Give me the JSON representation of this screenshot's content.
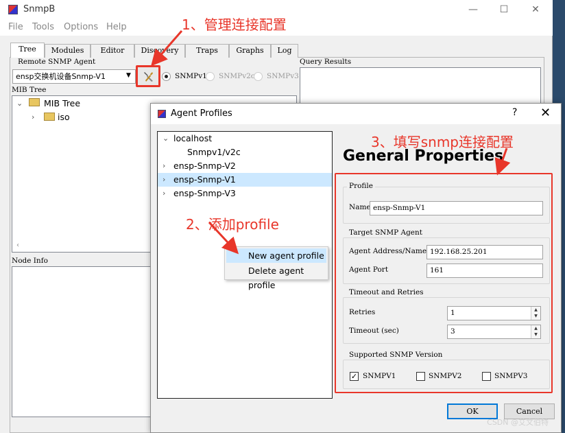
{
  "window": {
    "title": "SnmpB"
  },
  "menu": [
    "File",
    "Tools",
    "Options",
    "Help"
  ],
  "tabs": [
    "Tree",
    "Modules",
    "Editor",
    "Discovery",
    "Traps",
    "Graphs",
    "Log"
  ],
  "remote_agent": {
    "group_label": "Remote SNMP Agent",
    "selected_agent": "ensp交换机设备Snmp-V1",
    "versions": [
      "SNMPv1",
      "SNMPv2c",
      "SNMPv3"
    ],
    "selected_version": "SNMPv1"
  },
  "query_results_label": "Query Results",
  "mib_tree": {
    "label": "MIB Tree",
    "root": "MIB Tree",
    "child": "iso"
  },
  "node_info_label": "Node Info",
  "dialog": {
    "title": "Agent Profiles",
    "help": "?",
    "close": "✕",
    "profiles": [
      {
        "name": "localhost",
        "expanded": true
      },
      {
        "name": "Snmpv1/v2c",
        "child": true
      },
      {
        "name": "ensp-Snmp-V2"
      },
      {
        "name": "ensp-Snmp-V1",
        "selected": true
      },
      {
        "name": "ensp-Snmp-V3"
      }
    ],
    "context_menu": [
      "New agent profile",
      "Delete agent profile"
    ],
    "heading": "General Properties",
    "profile": {
      "legend": "Profile",
      "name_label": "Name",
      "name_value": "ensp-Snmp-V1"
    },
    "target": {
      "legend": "Target SNMP Agent",
      "address_label": "Agent Address/Name",
      "address_value": "192.168.25.201",
      "port_label": "Agent Port",
      "port_value": "161"
    },
    "timeout": {
      "legend": "Timeout and Retries",
      "retries_label": "Retries",
      "retries_value": "1",
      "timeout_label": "Timeout (sec)",
      "timeout_value": "3"
    },
    "version": {
      "legend": "Supported SNMP Version",
      "options": [
        "SNMPV1",
        "SNMPV2",
        "SNMPV3"
      ],
      "checked": [
        true,
        false,
        false
      ]
    },
    "ok_label": "OK",
    "cancel_label": "Cancel"
  },
  "annotations": {
    "step1": "1、管理连接配置",
    "step2": "2、添加profile",
    "step3": "3、填写snmp连接配置"
  },
  "watermark": "CSDN @艾文伯特",
  "colors": {
    "annotation_red": "#e8362a",
    "selection_blue": "#cce8ff",
    "default_button_border": "#0078d7"
  }
}
